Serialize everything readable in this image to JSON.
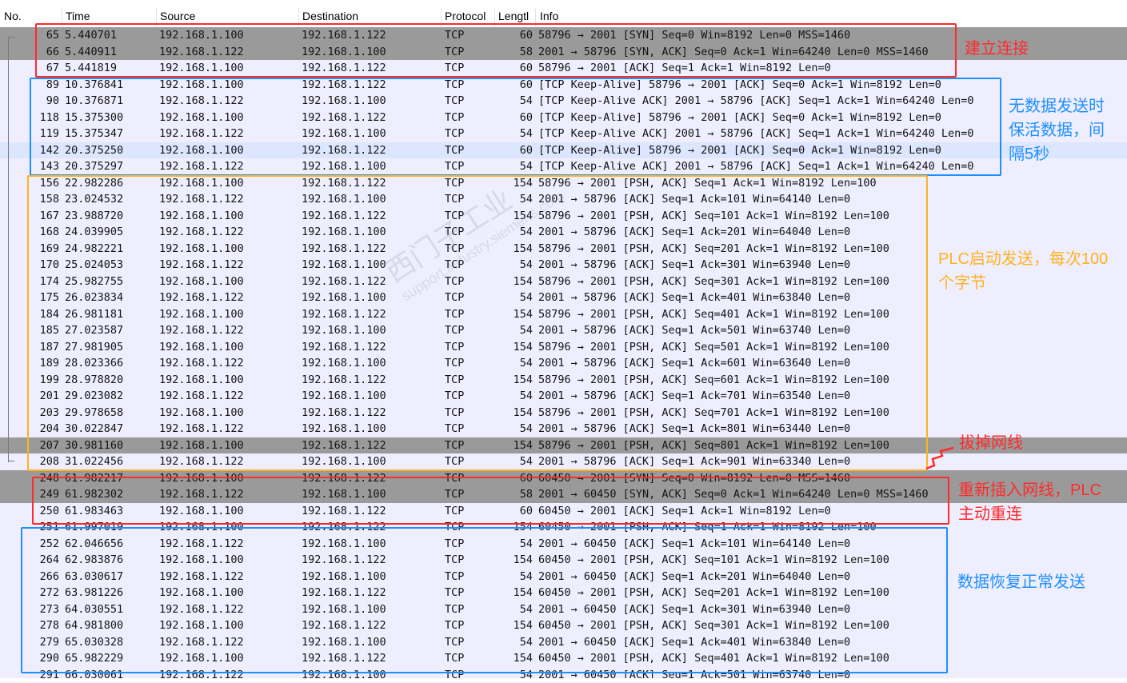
{
  "columns": [
    "No.",
    "Time",
    "Source",
    "Destination",
    "Protocol",
    "Lengtl",
    "Info"
  ],
  "colors": {
    "red": "#ff2a2a",
    "blue": "#1e8fff",
    "orange": "#ffb21e",
    "dark_row": "#9a9a9a",
    "selected_row": "#dde6ff"
  },
  "packets": [
    {
      "no": "65",
      "time": "5.440701",
      "src": "192.168.1.100",
      "dst": "192.168.1.122",
      "proto": "TCP",
      "len": "60",
      "info": "58796 → 2001 [SYN] Seq=0 Win=8192 Len=0 MSS=1460",
      "style": "dark"
    },
    {
      "no": "66",
      "time": "5.440911",
      "src": "192.168.1.122",
      "dst": "192.168.1.100",
      "proto": "TCP",
      "len": "58",
      "info": "2001 → 58796 [SYN, ACK] Seq=0 Ack=1 Win=64240 Len=0 MSS=1460",
      "style": "dark"
    },
    {
      "no": "67",
      "time": "5.441819",
      "src": "192.168.1.100",
      "dst": "192.168.1.122",
      "proto": "TCP",
      "len": "60",
      "info": "58796 → 2001 [ACK] Seq=1 Ack=1 Win=8192 Len=0",
      "style": "light"
    },
    {
      "no": "89",
      "time": "10.376841",
      "src": "192.168.1.100",
      "dst": "192.168.1.122",
      "proto": "TCP",
      "len": "60",
      "info": "[TCP Keep-Alive] 58796 → 2001 [ACK] Seq=0 Ack=1 Win=8192 Len=0",
      "style": "light"
    },
    {
      "no": "90",
      "time": "10.376871",
      "src": "192.168.1.122",
      "dst": "192.168.1.100",
      "proto": "TCP",
      "len": "54",
      "info": "[TCP Keep-Alive ACK] 2001 → 58796 [ACK] Seq=1 Ack=1 Win=64240 Len=0",
      "style": "light"
    },
    {
      "no": "118",
      "time": "15.375300",
      "src": "192.168.1.100",
      "dst": "192.168.1.122",
      "proto": "TCP",
      "len": "60",
      "info": "[TCP Keep-Alive] 58796 → 2001 [ACK] Seq=0 Ack=1 Win=8192 Len=0",
      "style": "light"
    },
    {
      "no": "119",
      "time": "15.375347",
      "src": "192.168.1.122",
      "dst": "192.168.1.100",
      "proto": "TCP",
      "len": "54",
      "info": "[TCP Keep-Alive ACK] 2001 → 58796 [ACK] Seq=1 Ack=1 Win=64240 Len=0",
      "style": "light"
    },
    {
      "no": "142",
      "time": "20.375250",
      "src": "192.168.1.100",
      "dst": "192.168.1.122",
      "proto": "TCP",
      "len": "60",
      "info": "[TCP Keep-Alive] 58796 → 2001 [ACK] Seq=0 Ack=1 Win=8192 Len=0",
      "style": "sel"
    },
    {
      "no": "143",
      "time": "20.375297",
      "src": "192.168.1.122",
      "dst": "192.168.1.100",
      "proto": "TCP",
      "len": "54",
      "info": "[TCP Keep-Alive ACK] 2001 → 58796 [ACK] Seq=1 Ack=1 Win=64240 Len=0",
      "style": "light"
    },
    {
      "no": "156",
      "time": "22.982286",
      "src": "192.168.1.100",
      "dst": "192.168.1.122",
      "proto": "TCP",
      "len": "154",
      "info": "58796 → 2001 [PSH, ACK] Seq=1 Ack=1 Win=8192 Len=100",
      "style": "light"
    },
    {
      "no": "158",
      "time": "23.024532",
      "src": "192.168.1.122",
      "dst": "192.168.1.100",
      "proto": "TCP",
      "len": "54",
      "info": "2001 → 58796 [ACK] Seq=1 Ack=101 Win=64140 Len=0",
      "style": "light"
    },
    {
      "no": "167",
      "time": "23.988720",
      "src": "192.168.1.100",
      "dst": "192.168.1.122",
      "proto": "TCP",
      "len": "154",
      "info": "58796 → 2001 [PSH, ACK] Seq=101 Ack=1 Win=8192 Len=100",
      "style": "light"
    },
    {
      "no": "168",
      "time": "24.039905",
      "src": "192.168.1.122",
      "dst": "192.168.1.100",
      "proto": "TCP",
      "len": "54",
      "info": "2001 → 58796 [ACK] Seq=1 Ack=201 Win=64040 Len=0",
      "style": "light"
    },
    {
      "no": "169",
      "time": "24.982221",
      "src": "192.168.1.100",
      "dst": "192.168.1.122",
      "proto": "TCP",
      "len": "154",
      "info": "58796 → 2001 [PSH, ACK] Seq=201 Ack=1 Win=8192 Len=100",
      "style": "light"
    },
    {
      "no": "170",
      "time": "25.024053",
      "src": "192.168.1.122",
      "dst": "192.168.1.100",
      "proto": "TCP",
      "len": "54",
      "info": "2001 → 58796 [ACK] Seq=1 Ack=301 Win=63940 Len=0",
      "style": "light"
    },
    {
      "no": "174",
      "time": "25.982755",
      "src": "192.168.1.100",
      "dst": "192.168.1.122",
      "proto": "TCP",
      "len": "154",
      "info": "58796 → 2001 [PSH, ACK] Seq=301 Ack=1 Win=8192 Len=100",
      "style": "light"
    },
    {
      "no": "175",
      "time": "26.023834",
      "src": "192.168.1.122",
      "dst": "192.168.1.100",
      "proto": "TCP",
      "len": "54",
      "info": "2001 → 58796 [ACK] Seq=1 Ack=401 Win=63840 Len=0",
      "style": "light"
    },
    {
      "no": "184",
      "time": "26.981181",
      "src": "192.168.1.100",
      "dst": "192.168.1.122",
      "proto": "TCP",
      "len": "154",
      "info": "58796 → 2001 [PSH, ACK] Seq=401 Ack=1 Win=8192 Len=100",
      "style": "light"
    },
    {
      "no": "185",
      "time": "27.023587",
      "src": "192.168.1.122",
      "dst": "192.168.1.100",
      "proto": "TCP",
      "len": "54",
      "info": "2001 → 58796 [ACK] Seq=1 Ack=501 Win=63740 Len=0",
      "style": "light"
    },
    {
      "no": "187",
      "time": "27.981905",
      "src": "192.168.1.100",
      "dst": "192.168.1.122",
      "proto": "TCP",
      "len": "154",
      "info": "58796 → 2001 [PSH, ACK] Seq=501 Ack=1 Win=8192 Len=100",
      "style": "light"
    },
    {
      "no": "189",
      "time": "28.023366",
      "src": "192.168.1.122",
      "dst": "192.168.1.100",
      "proto": "TCP",
      "len": "54",
      "info": "2001 → 58796 [ACK] Seq=1 Ack=601 Win=63640 Len=0",
      "style": "light"
    },
    {
      "no": "199",
      "time": "28.978820",
      "src": "192.168.1.100",
      "dst": "192.168.1.122",
      "proto": "TCP",
      "len": "154",
      "info": "58796 → 2001 [PSH, ACK] Seq=601 Ack=1 Win=8192 Len=100",
      "style": "light"
    },
    {
      "no": "201",
      "time": "29.023082",
      "src": "192.168.1.122",
      "dst": "192.168.1.100",
      "proto": "TCP",
      "len": "54",
      "info": "2001 → 58796 [ACK] Seq=1 Ack=701 Win=63540 Len=0",
      "style": "light"
    },
    {
      "no": "203",
      "time": "29.978658",
      "src": "192.168.1.100",
      "dst": "192.168.1.122",
      "proto": "TCP",
      "len": "154",
      "info": "58796 → 2001 [PSH, ACK] Seq=701 Ack=1 Win=8192 Len=100",
      "style": "light"
    },
    {
      "no": "204",
      "time": "30.022847",
      "src": "192.168.1.122",
      "dst": "192.168.1.100",
      "proto": "TCP",
      "len": "54",
      "info": "2001 → 58796 [ACK] Seq=1 Ack=801 Win=63440 Len=0",
      "style": "light"
    },
    {
      "no": "207",
      "time": "30.981160",
      "src": "192.168.1.100",
      "dst": "192.168.1.122",
      "proto": "TCP",
      "len": "154",
      "info": "58796 → 2001 [PSH, ACK] Seq=801 Ack=1 Win=8192 Len=100",
      "style": "dark"
    },
    {
      "no": "208",
      "time": "31.022456",
      "src": "192.168.1.122",
      "dst": "192.168.1.100",
      "proto": "TCP",
      "len": "54",
      "info": "2001 → 58796 [ACK] Seq=1 Ack=901 Win=63340 Len=0",
      "style": "light"
    },
    {
      "no": "248",
      "time": "61.982217",
      "src": "192.168.1.100",
      "dst": "192.168.1.122",
      "proto": "TCP",
      "len": "60",
      "info": "60450 → 2001 [SYN] Seq=0 Win=8192 Len=0 MSS=1460",
      "style": "dark"
    },
    {
      "no": "249",
      "time": "61.982302",
      "src": "192.168.1.122",
      "dst": "192.168.1.100",
      "proto": "TCP",
      "len": "58",
      "info": "2001 → 60450 [SYN, ACK] Seq=0 Ack=1 Win=64240 Len=0 MSS=1460",
      "style": "dark"
    },
    {
      "no": "250",
      "time": "61.983463",
      "src": "192.168.1.100",
      "dst": "192.168.1.122",
      "proto": "TCP",
      "len": "60",
      "info": "60450 → 2001 [ACK] Seq=1 Ack=1 Win=8192 Len=0",
      "style": "light"
    },
    {
      "no": "251",
      "time": "61.997019",
      "src": "192.168.1.100",
      "dst": "192.168.1.122",
      "proto": "TCP",
      "len": "154",
      "info": "60450 → 2001 [PSH, ACK] Seq=1 Ack=1 Win=8192 Len=100",
      "style": "light"
    },
    {
      "no": "252",
      "time": "62.046656",
      "src": "192.168.1.122",
      "dst": "192.168.1.100",
      "proto": "TCP",
      "len": "54",
      "info": "2001 → 60450 [ACK] Seq=1 Ack=101 Win=64140 Len=0",
      "style": "light"
    },
    {
      "no": "264",
      "time": "62.983876",
      "src": "192.168.1.100",
      "dst": "192.168.1.122",
      "proto": "TCP",
      "len": "154",
      "info": "60450 → 2001 [PSH, ACK] Seq=101 Ack=1 Win=8192 Len=100",
      "style": "light"
    },
    {
      "no": "266",
      "time": "63.030617",
      "src": "192.168.1.122",
      "dst": "192.168.1.100",
      "proto": "TCP",
      "len": "54",
      "info": "2001 → 60450 [ACK] Seq=1 Ack=201 Win=64040 Len=0",
      "style": "light"
    },
    {
      "no": "272",
      "time": "63.981226",
      "src": "192.168.1.100",
      "dst": "192.168.1.122",
      "proto": "TCP",
      "len": "154",
      "info": "60450 → 2001 [PSH, ACK] Seq=201 Ack=1 Win=8192 Len=100",
      "style": "light"
    },
    {
      "no": "273",
      "time": "64.030551",
      "src": "192.168.1.122",
      "dst": "192.168.1.100",
      "proto": "TCP",
      "len": "54",
      "info": "2001 → 60450 [ACK] Seq=1 Ack=301 Win=63940 Len=0",
      "style": "light"
    },
    {
      "no": "278",
      "time": "64.981800",
      "src": "192.168.1.100",
      "dst": "192.168.1.122",
      "proto": "TCP",
      "len": "154",
      "info": "60450 → 2001 [PSH, ACK] Seq=301 Ack=1 Win=8192 Len=100",
      "style": "light"
    },
    {
      "no": "279",
      "time": "65.030328",
      "src": "192.168.1.122",
      "dst": "192.168.1.100",
      "proto": "TCP",
      "len": "54",
      "info": "2001 → 60450 [ACK] Seq=1 Ack=401 Win=63840 Len=0",
      "style": "light"
    },
    {
      "no": "290",
      "time": "65.982229",
      "src": "192.168.1.100",
      "dst": "192.168.1.122",
      "proto": "TCP",
      "len": "154",
      "info": "60450 → 2001 [PSH, ACK] Seq=401 Ack=1 Win=8192 Len=100",
      "style": "light"
    },
    {
      "no": "291",
      "time": "66.030061",
      "src": "192.168.1.122",
      "dst": "192.168.1.100",
      "proto": "TCP",
      "len": "54",
      "info": "2001 → 60450 [ACK] Seq=1 Ack=501 Win=63740 Len=0",
      "style": "light"
    }
  ],
  "annotations": {
    "connect": "建立连接",
    "keepalive": "无数据发送时\n保活数据，间\n隔5秒",
    "plc_send": "PLC启动发送，每次100\n个字节",
    "unplug": "拔掉网线",
    "replug": "重新插入网线，PLC\n主动重连",
    "recover": "数据恢复正常发送"
  },
  "watermark": {
    "line1": "西门子工业",
    "line2": "support.industry.siemens.com"
  }
}
